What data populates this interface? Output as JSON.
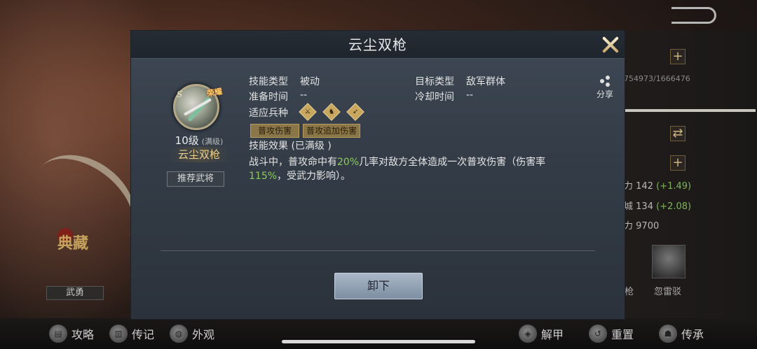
{
  "dialog": {
    "title": "云尘双枪",
    "share_label": "分享"
  },
  "skill": {
    "grade": "S",
    "badge": "荣耀",
    "level": "10级",
    "level_note": "(满级)",
    "name": "云尘双枪",
    "recommend_label": "推荐武将"
  },
  "info": {
    "skill_type_label": "技能类型",
    "skill_type_value": "被动",
    "target_type_label": "目标类型",
    "target_type_value": "敌军群体",
    "prep_time_label": "准备时间",
    "prep_time_value": "--",
    "cooldown_label": "冷却时间",
    "cooldown_value": "--",
    "troop_label": "适应兵种",
    "troops": [
      "⚔",
      "♞",
      "➶"
    ],
    "tags": [
      "普攻伤害",
      "普攻追加伤害"
    ]
  },
  "effect": {
    "title": "技能效果 (已满级 )",
    "text_1": "战斗中，普攻命中有",
    "highlight_1": "20%",
    "text_2": "几率对敌方全体造成一次普攻伤害（伤害率",
    "highlight_2": "115%",
    "text_3": "，受武力影响）。"
  },
  "buttons": {
    "unequip": "卸下"
  },
  "background": {
    "right_panel": {
      "counter": "754973/1666476",
      "stat_1_name": "力",
      "stat_1_value": "142",
      "stat_1_bonus": "(+1.49)",
      "stat_2_name": "城",
      "stat_2_value": "134",
      "stat_2_bonus": "(+2.08)",
      "stat_3_name": "力",
      "stat_3_value": "9700",
      "card_1_label": "双枪",
      "card_2_label": "忽雷驳"
    },
    "left": {
      "dian_text": "典藏",
      "wuyong_label": "武勇"
    }
  },
  "bottom_nav": {
    "guide": "攻略",
    "biography": "传记",
    "appearance": "外观",
    "unarmor": "解甲",
    "reset": "重置",
    "inherit": "传承"
  },
  "colors": {
    "highlight_green": "#8ccb5a",
    "gold": "#f1d08a",
    "tag_bg": "#8a7648"
  }
}
